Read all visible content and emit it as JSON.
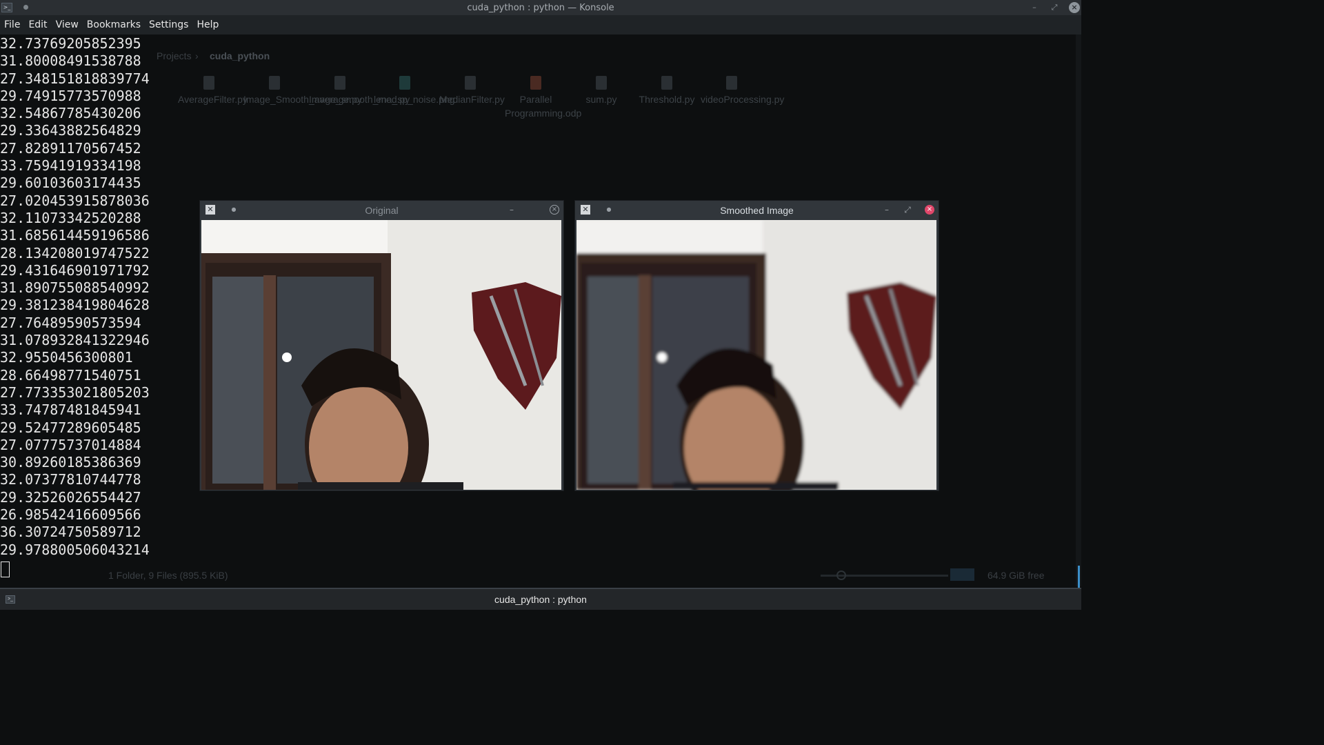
{
  "window": {
    "title": "cuda_python : python — Konsole",
    "menu": [
      "File",
      "Edit",
      "View",
      "Bookmarks",
      "Settings",
      "Help"
    ]
  },
  "background_file_manager": {
    "breadcrumb": [
      "Projects",
      "cuda_python"
    ],
    "files": [
      {
        "name": "AverageFilter.py",
        "kind": "text"
      },
      {
        "name": "Image_Smooth_average.py",
        "kind": "text"
      },
      {
        "name": "Image_smooth_med.py",
        "kind": "text"
      },
      {
        "name": "lena_sp_noise.png",
        "kind": "image"
      },
      {
        "name": "MedianFilter.py",
        "kind": "text"
      },
      {
        "name": "Parallel Programming.odp",
        "kind": "odp"
      },
      {
        "name": "sum.py",
        "kind": "text"
      },
      {
        "name": "Threshold.py",
        "kind": "text"
      },
      {
        "name": "videoProcessing.py",
        "kind": "text"
      }
    ],
    "status": "1 Folder, 9 Files (895.5 KiB)",
    "free_space": "64.9 GiB free"
  },
  "terminal": {
    "output": [
      "32.73769205852395",
      "31.80008491538788",
      "27.348151818839774",
      "29.74915773570988",
      "32.54867785430206",
      "29.33643882564829",
      "27.82891170567452",
      "33.75941919334198",
      "29.60103603174435",
      "27.020453915878036",
      "32.11073342520288",
      "31.685614459196586",
      "28.134208019747522",
      "29.431646901971792",
      "31.890755088540992",
      "29.381238419804628",
      "27.76489590573594",
      "31.078932841322946",
      "32.9550456300801",
      "28.66498771540751",
      "27.773353021805203",
      "33.74787481845941",
      "29.52477289605485",
      "27.07775737014884",
      "30.89260185386369",
      "32.07377810744778",
      "29.32526026554427",
      "26.98542416609566",
      "36.30724750589712",
      "29.978800506043214"
    ]
  },
  "image_windows": {
    "original": {
      "title": "Original"
    },
    "smoothed": {
      "title": "Smoothed Image"
    }
  },
  "tab": {
    "title": "cuda_python : python"
  },
  "icons": {
    "close": "close-icon",
    "minimize": "minimize-icon",
    "maximize": "maximize-icon",
    "pin": "pin-icon"
  },
  "colors": {
    "titlebar": "#2b2f33",
    "terminal_bg": "#0d0f10",
    "close_active": "#e0476a",
    "accent": "#3b8ec8"
  }
}
